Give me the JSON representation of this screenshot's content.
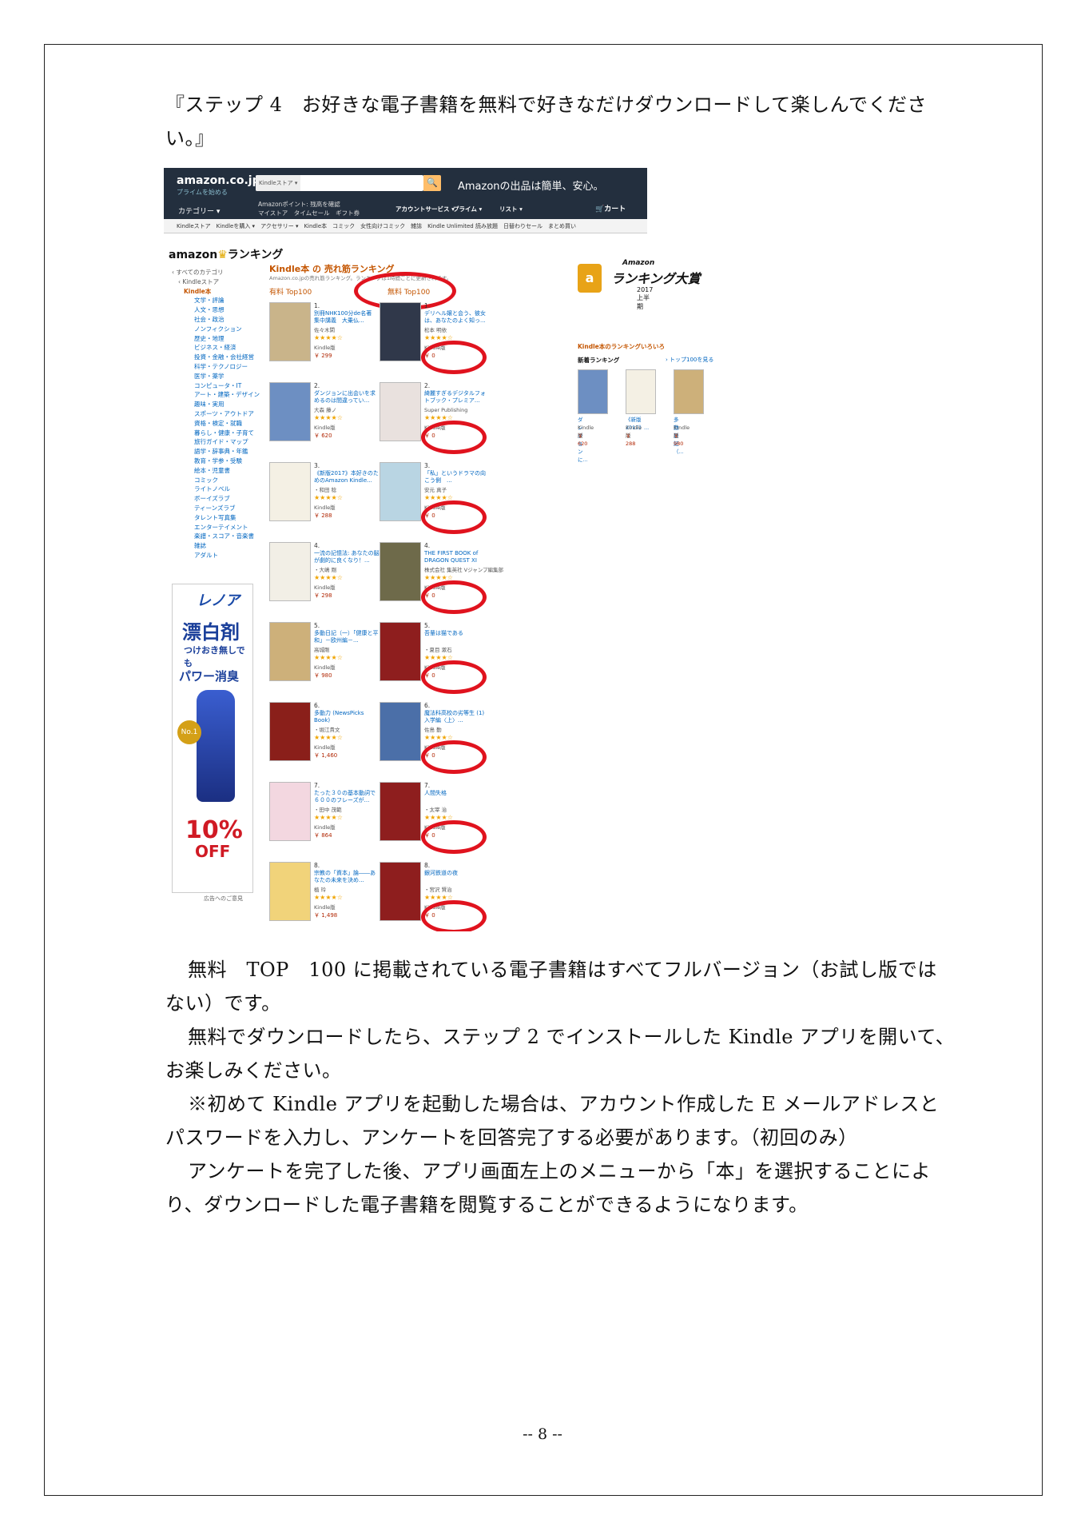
{
  "doc": {
    "step_heading": "『ステップ 4　お好きな電子書籍を無料で好きなだけダウンロードして楽しんでください。』",
    "para1": "無料　TOP　100 に掲載されている電子書籍はすべてフルバージョン（お試し版ではない）です。",
    "para2": "無料でダウンロードしたら、ステップ 2 でインストールした Kindle アプリを開いて、お楽しみください。",
    "para3": "※初めて Kindle アプリを起動した場合は、アカウント作成した E メールアドレスとパスワードを入力し、アンケートを回答完了する必要があります。（初回のみ）",
    "para4": "アンケートを完了した後、アプリ画面左上のメニューから「本」を選択することにより、ダウンロードした電子書籍を閲覧することができるようになります。",
    "page_number": "-- 8 --"
  },
  "screenshot": {
    "header": {
      "logo": "amazon.co.jp",
      "logo_sub": "プライムを始める",
      "search_scope": "Kindleストア ▾",
      "search_icon": "🔍",
      "promo": "Amazonの出品は簡単、安心。",
      "categories": "カテゴリー ▾",
      "points": "Amazonポイント: 残高を確認",
      "links": "マイストア　タイムセール　ギフト券",
      "account": "アカウントサービス ▾",
      "prime": "プライム ▾",
      "wishlist": "リスト ▾",
      "cart": "カート"
    },
    "subnav": "Kindleストア　Kindleを購入 ▾　アクセサリー ▾　Kindle本　コミック　女性向けコミック　雑誌　Kindle Unlimited 読み放題　日替わりセール　まとめ買い",
    "ranking_logo": "amazon",
    "ranking_logo_text": "ランキング",
    "sidebar": {
      "root": "‹ すべてのカテゴリ",
      "store": "‹ Kindleストア",
      "current": "Kindle本",
      "items": [
        "文学・評論",
        "人文・思想",
        "社会・政治",
        "ノンフィクション",
        "歴史・地理",
        "ビジネス・経済",
        "投資・金融・会社経営",
        "科学・テクノロジー",
        "医学・薬学",
        "コンピュータ・IT",
        "アート・建築・デザイン",
        "趣味・実用",
        "スポーツ・アウトドア",
        "資格・検定・就職",
        "暮らし・健康・子育て",
        "旅行ガイド・マップ",
        "語学・辞事典・年鑑",
        "教育・学参・受験",
        "絵本・児童書",
        "コミック",
        "ライトノベル",
        "ボーイズラブ",
        "ティーンズラブ",
        "タレント写真集",
        "エンターテイメント",
        "楽譜・スコア・音楽書",
        "雑誌",
        "アダルト"
      ]
    },
    "ad": {
      "brand": "レノア",
      "line1": "漂白剤",
      "line2": "つけおき無しでも",
      "line3": "パワー消臭",
      "medal": "No.1",
      "off_num": "10%",
      "off_word": "OFF",
      "footer": "広告へのご意見"
    },
    "list_title": "Kindle本 の 売れ筋ランキング",
    "list_desc": "Amazon.co.jpの売れ筋ランキング。ランキングは1時間ごとに更新されます。",
    "tab_paid": "有料 Top100",
    "tab_free": "無料 Top100",
    "paid": [
      {
        "rank": "1.",
        "title": "別冊NHK100分de名著　集中講義　大乗仏...",
        "author": "佐々木閑",
        "price": "￥ 299",
        "color": "#c9b48a"
      },
      {
        "rank": "2.",
        "title": "ダンジョンに出会いを求めるのは間違ってい...",
        "author": "大森 藤ノ",
        "price": "￥ 620",
        "color": "#6d8fc2"
      },
      {
        "rank": "3.",
        "title": "《新版2017》本好きのためのAmazon Kindle...",
        "author": "・和田 稔",
        "price": "￥ 288",
        "color": "#f4f0e4"
      },
      {
        "rank": "4.",
        "title": "一流の記憶法: あなたの脳が劇的に良くなり！...",
        "author": "・大嶋 剛",
        "price": "￥ 298",
        "color": "#f2efe6"
      },
      {
        "rank": "5.",
        "title": "多動日記（一）「健康と平和」－欧州編－...",
        "author": "高城剛",
        "price": "￥ 980",
        "color": "#cdb07a"
      },
      {
        "rank": "6.",
        "title": "多動力 (NewsPicks Book)",
        "author": "・堀江貴文",
        "price": "￥ 1,460",
        "color": "#8a1f1a"
      },
      {
        "rank": "7.",
        "title": "たった３０の基本動詞で６００のフレーズが...",
        "author": "・田中 茂範",
        "price": "￥ 864",
        "color": "#f3d7e0"
      },
      {
        "rank": "8.",
        "title": "宗教の「資本」論――あなたの未来を決め...",
        "author": "植 玲",
        "price": "￥ 1,498",
        "color": "#f1d37a"
      }
    ],
    "free": [
      {
        "rank": "1.",
        "title": "デリヘル嬢と会う、彼女は、あなたのよく知っ...",
        "author": "松本 明依",
        "price": "￥ 0",
        "color": "#30384a"
      },
      {
        "rank": "2.",
        "title": "綺麗すぎるデジタルフォトブック・プレミア...",
        "author": "Super Publishing",
        "price": "￥ 0",
        "color": "#e9e1de"
      },
      {
        "rank": "3.",
        "title": "「私」というドラマの向こう側　...",
        "author": "安元 真子",
        "price": "￥ 0",
        "color": "#b9d5e3"
      },
      {
        "rank": "4.",
        "title": "THE FIRST BOOK of DRAGON QUEST XI",
        "author": "株式会社 集英社 Vジャンプ編集部",
        "price": "￥ 0",
        "color": "#6e6a4a"
      },
      {
        "rank": "5.",
        "title": "吾輩は猫である",
        "author": "・夏目 漱石",
        "price": "￥ 0",
        "color": "#8e1e1e"
      },
      {
        "rank": "6.",
        "title": "魔法科高校の劣等生 (1) 入学編〈上〉...",
        "author": "佐島 勤",
        "price": "￥ 0",
        "color": "#4b6fa8"
      },
      {
        "rank": "7.",
        "title": "人間失格",
        "author": "・太宰 治",
        "price": "￥ 0",
        "color": "#8e1e1e"
      },
      {
        "rank": "8.",
        "title": "銀河鉄道の夜",
        "author": "・宮沢 賢治",
        "price": "￥ 0",
        "color": "#8e1e1e"
      }
    ],
    "award": {
      "badge": "a",
      "line1": "Amazon",
      "line2": "ランキング大賞",
      "line3": "2017 上半期"
    },
    "right": {
      "variety": "Kindle本のランキングいろいろ",
      "new_label": "新着ランキング",
      "top100": "› トップ100を見る",
      "minis": [
        {
          "title": "ダンジョンに...",
          "format": "Kindle版",
          "price": "￥ 620",
          "color": "#6d8fc2"
        },
        {
          "title": "《新版2017》...",
          "format": "Kindle版",
          "price": "￥ 288",
          "color": "#f4f0e4"
        },
        {
          "title": "多動日記（...",
          "format": "Kindle版",
          "price": "￥ 980",
          "color": "#cdb07a"
        }
      ]
    },
    "kindle_format": "Kindle版",
    "accent": "#e0131e"
  }
}
